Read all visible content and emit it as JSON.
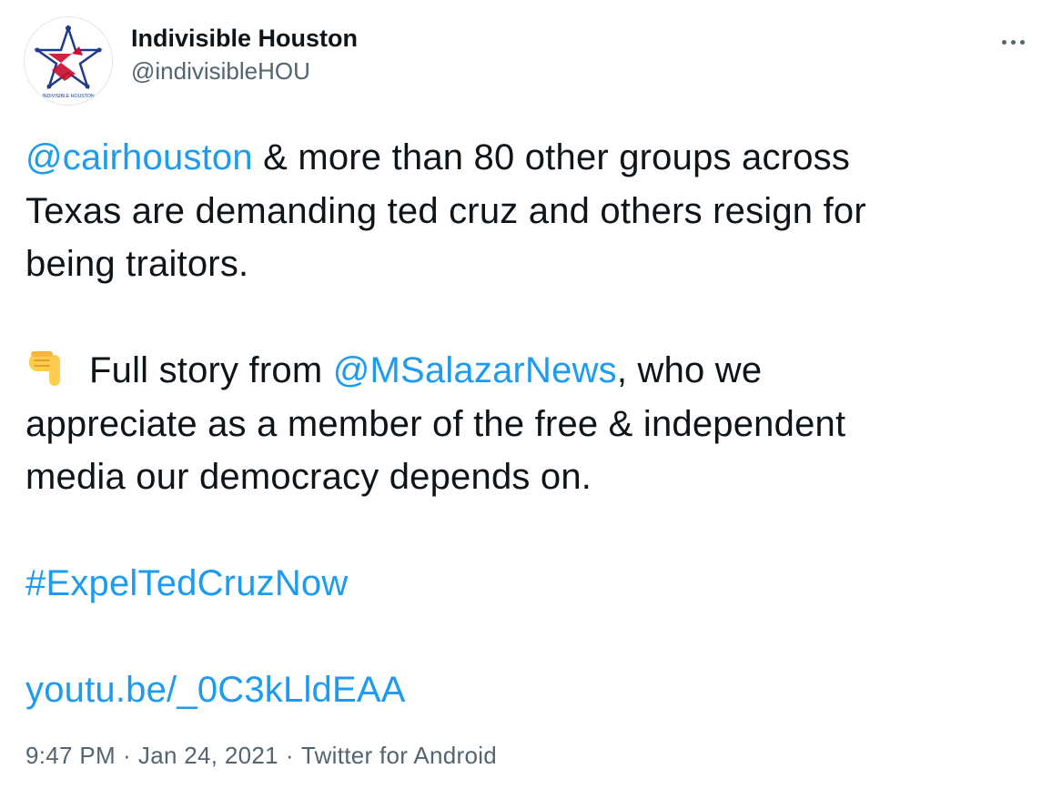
{
  "author": {
    "display_name": "Indivisible Houston",
    "handle": "@indivisibleHOU",
    "avatar_logo_text": "INDIVISIBLE HOUSTON",
    "brand_colors": {
      "red": "#c8102e",
      "blue": "#1f3a8a"
    }
  },
  "tweet": {
    "lines": [
      {
        "mention": "@cairhouston",
        "text": " & more than 80 other groups across"
      },
      {
        "text": "Texas are demanding ted cruz and others resign for"
      },
      {
        "text": "being traitors."
      },
      {
        "emoji": "backhand-index-pointing-down",
        "pre": "Full story from ",
        "mention": "@MSalazarNews",
        "post": ", who we"
      },
      {
        "text": "appreciate as a member of the free & independent"
      },
      {
        "text": "media our democracy depends on."
      }
    ],
    "hashtag": "#ExpelTedCruzNow",
    "link": "youtu.be/_0C3kLldEAA"
  },
  "meta": {
    "time": "9:47 PM",
    "date": "Jan 24, 2021",
    "source": "Twitter for Android",
    "separator": "·"
  },
  "colors": {
    "link": "#1d9bf0",
    "text": "#0f1419",
    "secondary": "#536471"
  },
  "icons": {
    "more": "more-horizontal-icon",
    "emoji": "pointing-down-emoji"
  }
}
